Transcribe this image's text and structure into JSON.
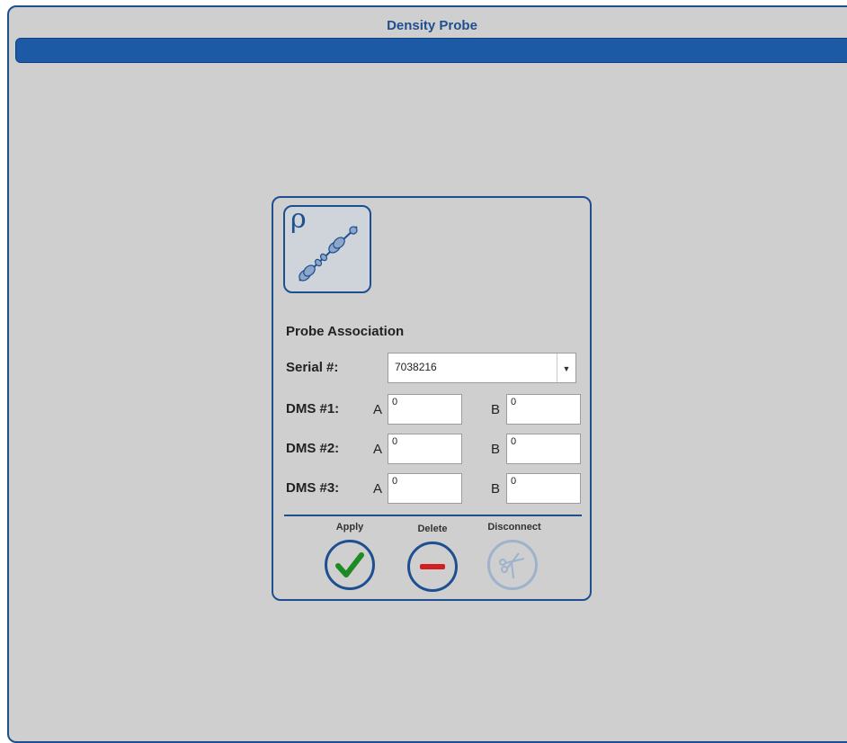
{
  "window": {
    "title": "Density Probe"
  },
  "panel": {
    "section_title": "Probe Association",
    "serial": {
      "label": "Serial #:",
      "value": "7038216"
    },
    "dms": [
      {
        "label": "DMS #1:",
        "a_label": "A",
        "a_value": "0",
        "b_label": "B",
        "b_value": "0"
      },
      {
        "label": "DMS #2:",
        "a_label": "A",
        "a_value": "0",
        "b_label": "B",
        "b_value": "0"
      },
      {
        "label": "DMS #3:",
        "a_label": "A",
        "a_value": "0",
        "b_label": "B",
        "b_value": "0"
      }
    ],
    "buttons": {
      "apply": "Apply",
      "delete": "Delete",
      "disconnect": "Disconnect"
    },
    "icons": {
      "probe": "density-probe-icon",
      "apply": "checkmark-icon",
      "delete": "minus-icon",
      "disconnect": "scissors-icon"
    }
  },
  "colors": {
    "accent": "#1d4f91",
    "title_bar": "#1d5aa6",
    "apply": "#1e8a24",
    "delete": "#d21f1f",
    "disabled": "#9fb2cc"
  }
}
